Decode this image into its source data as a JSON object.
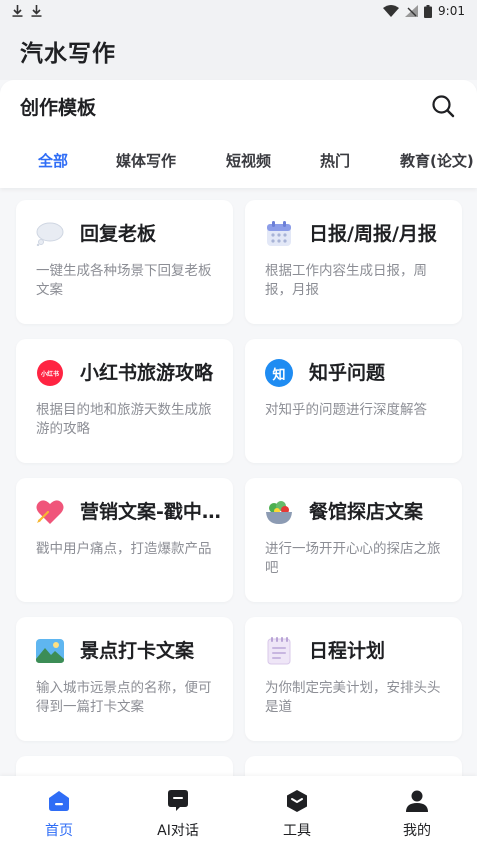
{
  "status_bar": {
    "time": "9:01"
  },
  "app": {
    "title": "汽水写作"
  },
  "panel": {
    "title": "创作模板"
  },
  "tabs": [
    {
      "label": "全部",
      "active": true
    },
    {
      "label": "媒体写作",
      "active": false
    },
    {
      "label": "短视频",
      "active": false
    },
    {
      "label": "热门",
      "active": false
    },
    {
      "label": "教育(论文)",
      "active": false
    }
  ],
  "cards": [
    {
      "title": "回复老板",
      "desc": "一键生成各种场景下回复老板文案",
      "icon": "speech-bubble-icon"
    },
    {
      "title": "日报/周报/月报",
      "desc": "根据工作内容生成日报，周报，月报",
      "icon": "calendar-icon"
    },
    {
      "title": "小红书旅游攻略",
      "desc": "根据目的地和旅游天数生成旅游的攻略",
      "icon": "xiaohongshu-icon",
      "badge": "小红书"
    },
    {
      "title": "知乎问题",
      "desc": "对知乎的问题进行深度解答",
      "icon": "zhihu-icon",
      "badge": "知"
    },
    {
      "title": "营销文案-戳中痛点",
      "desc": "戳中用户痛点，打造爆款产品",
      "icon": "heart-icon"
    },
    {
      "title": "餐馆探店文案",
      "desc": "进行一场开开心心的探店之旅吧",
      "icon": "salad-bowl-icon"
    },
    {
      "title": "景点打卡文案",
      "desc": "输入城市远景点的名称，便可得到一篇打卡文案",
      "icon": "landscape-icon"
    },
    {
      "title": "日程计划",
      "desc": "为你制定完美计划，安排头头是道",
      "icon": "notepad-icon"
    }
  ],
  "bottom_nav": [
    {
      "label": "首页",
      "active": true,
      "icon": "home-icon"
    },
    {
      "label": "AI对话",
      "active": false,
      "icon": "chat-icon"
    },
    {
      "label": "工具",
      "active": false,
      "icon": "toolbox-icon"
    },
    {
      "label": "我的",
      "active": false,
      "icon": "user-icon"
    }
  ],
  "colors": {
    "accent": "#2f6df6",
    "background": "#f6f7f9",
    "header": "#f1f2f4"
  }
}
